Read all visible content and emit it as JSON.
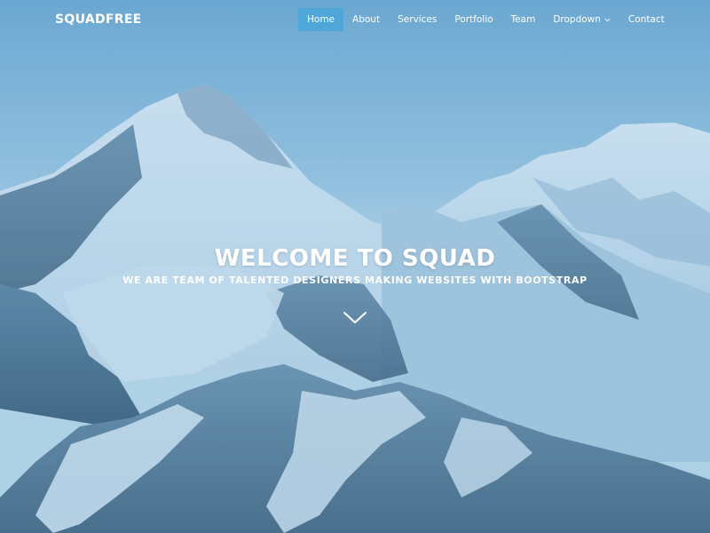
{
  "brand": {
    "logo_text": "SQUADFREE"
  },
  "nav": {
    "items": [
      {
        "label": "Home",
        "active": true
      },
      {
        "label": "About",
        "active": false
      },
      {
        "label": "Services",
        "active": false
      },
      {
        "label": "Portfolio",
        "active": false
      },
      {
        "label": "Team",
        "active": false
      },
      {
        "label": "Dropdown",
        "active": false,
        "has_dropdown": true,
        "icon": "chevron-down-icon"
      },
      {
        "label": "Contact",
        "active": false
      }
    ]
  },
  "hero": {
    "title": "WELCOME TO SQUAD",
    "subtitle": "WE ARE TEAM OF TALENTED DESIGNERS MAKING WEBSITES WITH BOOTSTRAP",
    "scroll_icon": "chevron-down-icon",
    "background": "mountain-landscape"
  },
  "colors": {
    "accent": "#4ea7d8",
    "text": "#ffffff",
    "overlay": "#5ca0cd"
  }
}
